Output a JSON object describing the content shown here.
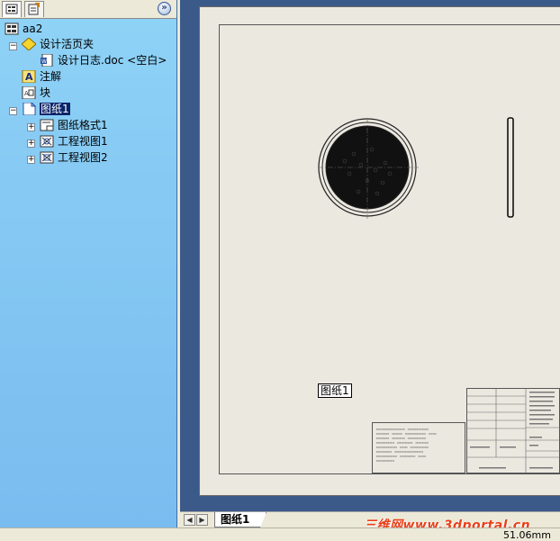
{
  "feature_tree": {
    "root": "aa2",
    "items": [
      {
        "label": "设计活页夹",
        "icon": "binder-icon"
      },
      {
        "label": "设计日志.doc <空白>",
        "icon": "word-doc-icon"
      },
      {
        "label": "注解",
        "icon": "annotation-icon"
      },
      {
        "label": "块",
        "icon": "block-icon"
      },
      {
        "label": "图纸1",
        "icon": "sheet-icon",
        "selected": true
      },
      {
        "label": "图纸格式1",
        "icon": "sheet-format-icon"
      },
      {
        "label": "工程视图1",
        "icon": "drawing-view-icon"
      },
      {
        "label": "工程视图2",
        "icon": "drawing-view-icon"
      }
    ]
  },
  "drawing": {
    "sheet_label": "图纸1"
  },
  "sheet_tabs": [
    {
      "label": "图纸1",
      "active": true
    }
  ],
  "status": {
    "measurement": "51.06mm"
  },
  "watermark": "三维网www.3dportal.cn",
  "colors": {
    "panel_top": "#8fd3f7",
    "panel_bottom": "#7abcef",
    "graphics_bg": "#3b5a8a",
    "sheet_bg": "#ebe8e0",
    "selection": "#0a246a",
    "watermark": "#e8401a"
  }
}
